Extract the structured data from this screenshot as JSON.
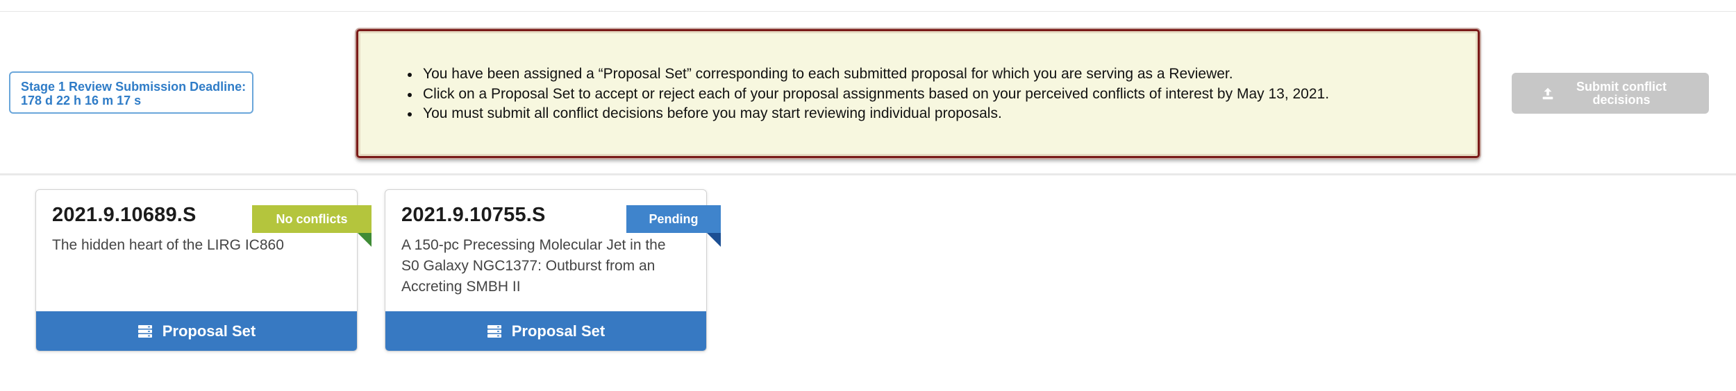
{
  "deadline": {
    "line1": "Stage 1 Review Submission Deadline:",
    "line2": "178 d 22 h 16 m 17 s"
  },
  "notice": {
    "items": [
      "You have been assigned a “Proposal Set” corresponding to each submitted proposal for which you are serving as a Reviewer.",
      "Click on a Proposal Set to accept or reject each of your proposal assignments based on your perceived conflicts of interest by May 13, 2021.",
      "You must submit all conflict decisions before you may start reviewing individual proposals."
    ]
  },
  "submit_button": {
    "label": "Submit conflict decisions",
    "icon": "upload-icon",
    "state": "disabled"
  },
  "cards": [
    {
      "id": "2021.9.10689.S",
      "title": "The hidden heart of the LIRG IC860",
      "status": "No conflicts",
      "status_color": "#b4c53d",
      "button_label": "Proposal Set",
      "button_icon": "server-stack-icon"
    },
    {
      "id": "2021.9.10755.S",
      "title": "A 150-pc Precessing Molecular Jet in the S0 Galaxy NGC1377: Outburst from an Accreting SMBH II",
      "status": "Pending",
      "status_color": "#3f84cc",
      "button_label": "Proposal Set",
      "button_icon": "server-stack-icon"
    }
  ],
  "colors": {
    "primary": "#3779c2",
    "notice_bg": "#f7f7df",
    "notice_border": "#7a1a18",
    "disabled": "#c7c7c7"
  }
}
